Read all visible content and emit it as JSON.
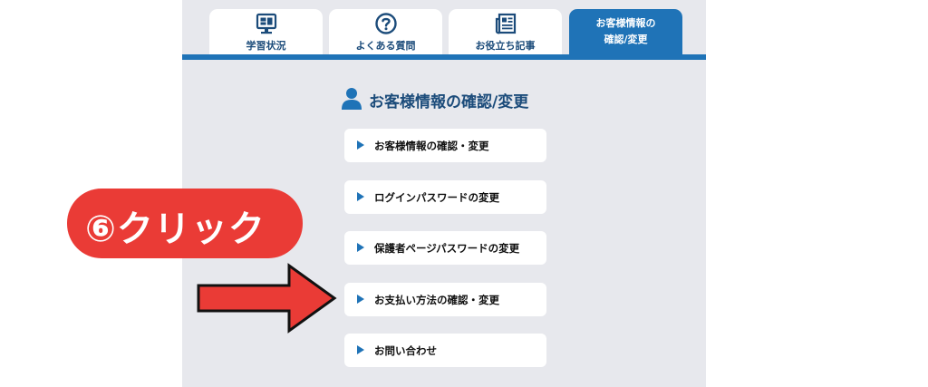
{
  "tabs": [
    {
      "label": "学習状況",
      "icon": "monitor-icon"
    },
    {
      "label": "よくある質問",
      "icon": "question-icon"
    },
    {
      "label": "お役立ち記事",
      "icon": "newspaper-icon"
    },
    {
      "label_line1": "お客様情報の",
      "label_line2": "確認/変更",
      "active": true
    }
  ],
  "section": {
    "title": "お客様情報の確認/変更",
    "icon": "person-icon"
  },
  "menu": [
    {
      "label": "お客様情報の確認・変更"
    },
    {
      "label": "ログインパスワードの変更"
    },
    {
      "label": "保護者ページパスワードの変更"
    },
    {
      "label": "お支払い方法の確認・変更"
    },
    {
      "label": "お問い合わせ"
    }
  ],
  "annotation": {
    "badge_text": "⑥クリック",
    "arrow": "right-arrow-icon"
  },
  "colors": {
    "accent": "#1f73b7",
    "panel_bg": "#e7e8ed",
    "callout_red": "#ea3b36"
  }
}
